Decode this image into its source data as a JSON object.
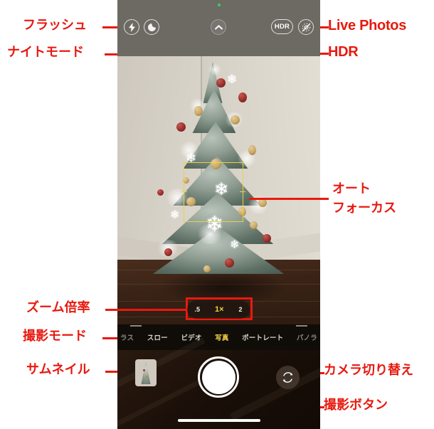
{
  "screen": {
    "app": "iPhone Camera",
    "green_privacy_dot": true
  },
  "top_controls": {
    "flash": {
      "label": "Flash",
      "icon": "flash-icon",
      "state": "auto"
    },
    "night_mode": {
      "label": "Night Mode",
      "icon": "moon-icon"
    },
    "chevron": {
      "label": "More Controls",
      "icon": "chevron-up-icon"
    },
    "hdr": {
      "label": "HDR",
      "icon": "hdr-badge"
    },
    "live_photos": {
      "label": "Live Photos",
      "icon": "live-photos-off-icon",
      "state": "off"
    }
  },
  "viewfinder": {
    "subject": "Frosted Christmas tree with red and gold ornaments",
    "autofocus_box": {
      "visible": true,
      "color": "#e8d14a"
    }
  },
  "zoom_control": {
    "options": [
      ".5",
      "1×",
      "2"
    ],
    "active_index": 1,
    "active_color": "#f5d13c"
  },
  "mode_bar": {
    "modes": [
      {
        "label": "ラス",
        "active": false,
        "edge": true
      },
      {
        "label": "スロー",
        "active": false,
        "edge": false
      },
      {
        "label": "ビデオ",
        "active": false,
        "edge": false
      },
      {
        "label": "写真",
        "active": true,
        "edge": false
      },
      {
        "label": "ポートレート",
        "active": false,
        "edge": false
      },
      {
        "label": "パノラ",
        "active": false,
        "edge": true
      }
    ],
    "active_color": "#f5d13c"
  },
  "bottom_bar": {
    "thumbnail": {
      "label": "Thumbnail"
    },
    "shutter": {
      "label": "Shutter"
    },
    "flip_camera": {
      "label": "Flip Camera",
      "icon": "camera-flip-icon"
    },
    "home_indicator": true
  },
  "annotations": {
    "color": "#e8190f",
    "items": [
      {
        "id": "flash",
        "text": "フラッシュ",
        "lang": "jp"
      },
      {
        "id": "night_mode",
        "text": "ナイトモード",
        "lang": "jp"
      },
      {
        "id": "live_photos",
        "text": "Live Photos",
        "lang": "en"
      },
      {
        "id": "hdr",
        "text": "HDR",
        "lang": "en"
      },
      {
        "id": "autofocus_1",
        "text": "オート",
        "lang": "jp"
      },
      {
        "id": "autofocus_2",
        "text": "フォーカス",
        "lang": "jp"
      },
      {
        "id": "zoom_ratio",
        "text": "ズーム倍率",
        "lang": "jp"
      },
      {
        "id": "shoot_mode",
        "text": "撮影モード",
        "lang": "jp"
      },
      {
        "id": "thumbnail",
        "text": "サムネイル",
        "lang": "jp"
      },
      {
        "id": "flip_camera",
        "text": "カメラ切り替え",
        "lang": "jp"
      },
      {
        "id": "shutter",
        "text": "撮影ボタン",
        "lang": "jp"
      }
    ]
  }
}
